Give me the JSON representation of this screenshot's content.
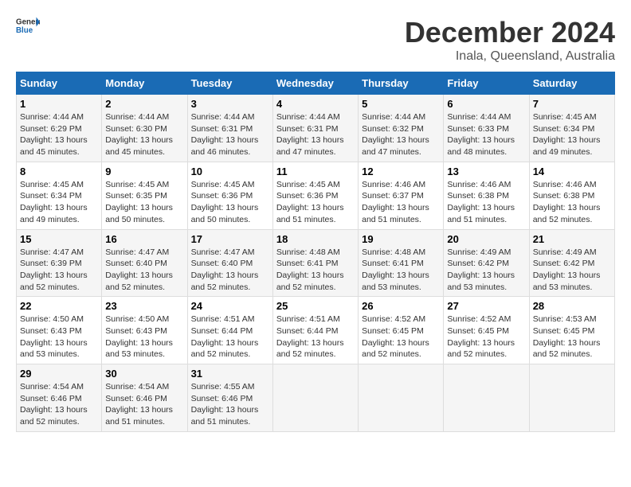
{
  "header": {
    "logo_general": "General",
    "logo_blue": "Blue",
    "month_title": "December 2024",
    "location": "Inala, Queensland, Australia"
  },
  "days_of_week": [
    "Sunday",
    "Monday",
    "Tuesday",
    "Wednesday",
    "Thursday",
    "Friday",
    "Saturday"
  ],
  "weeks": [
    [
      {
        "day": "1",
        "sunrise": "4:44 AM",
        "sunset": "6:29 PM",
        "daylight": "13 hours and 45 minutes."
      },
      {
        "day": "2",
        "sunrise": "4:44 AM",
        "sunset": "6:30 PM",
        "daylight": "13 hours and 45 minutes."
      },
      {
        "day": "3",
        "sunrise": "4:44 AM",
        "sunset": "6:31 PM",
        "daylight": "13 hours and 46 minutes."
      },
      {
        "day": "4",
        "sunrise": "4:44 AM",
        "sunset": "6:31 PM",
        "daylight": "13 hours and 47 minutes."
      },
      {
        "day": "5",
        "sunrise": "4:44 AM",
        "sunset": "6:32 PM",
        "daylight": "13 hours and 47 minutes."
      },
      {
        "day": "6",
        "sunrise": "4:44 AM",
        "sunset": "6:33 PM",
        "daylight": "13 hours and 48 minutes."
      },
      {
        "day": "7",
        "sunrise": "4:45 AM",
        "sunset": "6:34 PM",
        "daylight": "13 hours and 49 minutes."
      }
    ],
    [
      {
        "day": "8",
        "sunrise": "4:45 AM",
        "sunset": "6:34 PM",
        "daylight": "13 hours and 49 minutes."
      },
      {
        "day": "9",
        "sunrise": "4:45 AM",
        "sunset": "6:35 PM",
        "daylight": "13 hours and 50 minutes."
      },
      {
        "day": "10",
        "sunrise": "4:45 AM",
        "sunset": "6:36 PM",
        "daylight": "13 hours and 50 minutes."
      },
      {
        "day": "11",
        "sunrise": "4:45 AM",
        "sunset": "6:36 PM",
        "daylight": "13 hours and 51 minutes."
      },
      {
        "day": "12",
        "sunrise": "4:46 AM",
        "sunset": "6:37 PM",
        "daylight": "13 hours and 51 minutes."
      },
      {
        "day": "13",
        "sunrise": "4:46 AM",
        "sunset": "6:38 PM",
        "daylight": "13 hours and 51 minutes."
      },
      {
        "day": "14",
        "sunrise": "4:46 AM",
        "sunset": "6:38 PM",
        "daylight": "13 hours and 52 minutes."
      }
    ],
    [
      {
        "day": "15",
        "sunrise": "4:47 AM",
        "sunset": "6:39 PM",
        "daylight": "13 hours and 52 minutes."
      },
      {
        "day": "16",
        "sunrise": "4:47 AM",
        "sunset": "6:40 PM",
        "daylight": "13 hours and 52 minutes."
      },
      {
        "day": "17",
        "sunrise": "4:47 AM",
        "sunset": "6:40 PM",
        "daylight": "13 hours and 52 minutes."
      },
      {
        "day": "18",
        "sunrise": "4:48 AM",
        "sunset": "6:41 PM",
        "daylight": "13 hours and 52 minutes."
      },
      {
        "day": "19",
        "sunrise": "4:48 AM",
        "sunset": "6:41 PM",
        "daylight": "13 hours and 53 minutes."
      },
      {
        "day": "20",
        "sunrise": "4:49 AM",
        "sunset": "6:42 PM",
        "daylight": "13 hours and 53 minutes."
      },
      {
        "day": "21",
        "sunrise": "4:49 AM",
        "sunset": "6:42 PM",
        "daylight": "13 hours and 53 minutes."
      }
    ],
    [
      {
        "day": "22",
        "sunrise": "4:50 AM",
        "sunset": "6:43 PM",
        "daylight": "13 hours and 53 minutes."
      },
      {
        "day": "23",
        "sunrise": "4:50 AM",
        "sunset": "6:43 PM",
        "daylight": "13 hours and 53 minutes."
      },
      {
        "day": "24",
        "sunrise": "4:51 AM",
        "sunset": "6:44 PM",
        "daylight": "13 hours and 52 minutes."
      },
      {
        "day": "25",
        "sunrise": "4:51 AM",
        "sunset": "6:44 PM",
        "daylight": "13 hours and 52 minutes."
      },
      {
        "day": "26",
        "sunrise": "4:52 AM",
        "sunset": "6:45 PM",
        "daylight": "13 hours and 52 minutes."
      },
      {
        "day": "27",
        "sunrise": "4:52 AM",
        "sunset": "6:45 PM",
        "daylight": "13 hours and 52 minutes."
      },
      {
        "day": "28",
        "sunrise": "4:53 AM",
        "sunset": "6:45 PM",
        "daylight": "13 hours and 52 minutes."
      }
    ],
    [
      {
        "day": "29",
        "sunrise": "4:54 AM",
        "sunset": "6:46 PM",
        "daylight": "13 hours and 52 minutes."
      },
      {
        "day": "30",
        "sunrise": "4:54 AM",
        "sunset": "6:46 PM",
        "daylight": "13 hours and 51 minutes."
      },
      {
        "day": "31",
        "sunrise": "4:55 AM",
        "sunset": "6:46 PM",
        "daylight": "13 hours and 51 minutes."
      },
      null,
      null,
      null,
      null
    ]
  ]
}
